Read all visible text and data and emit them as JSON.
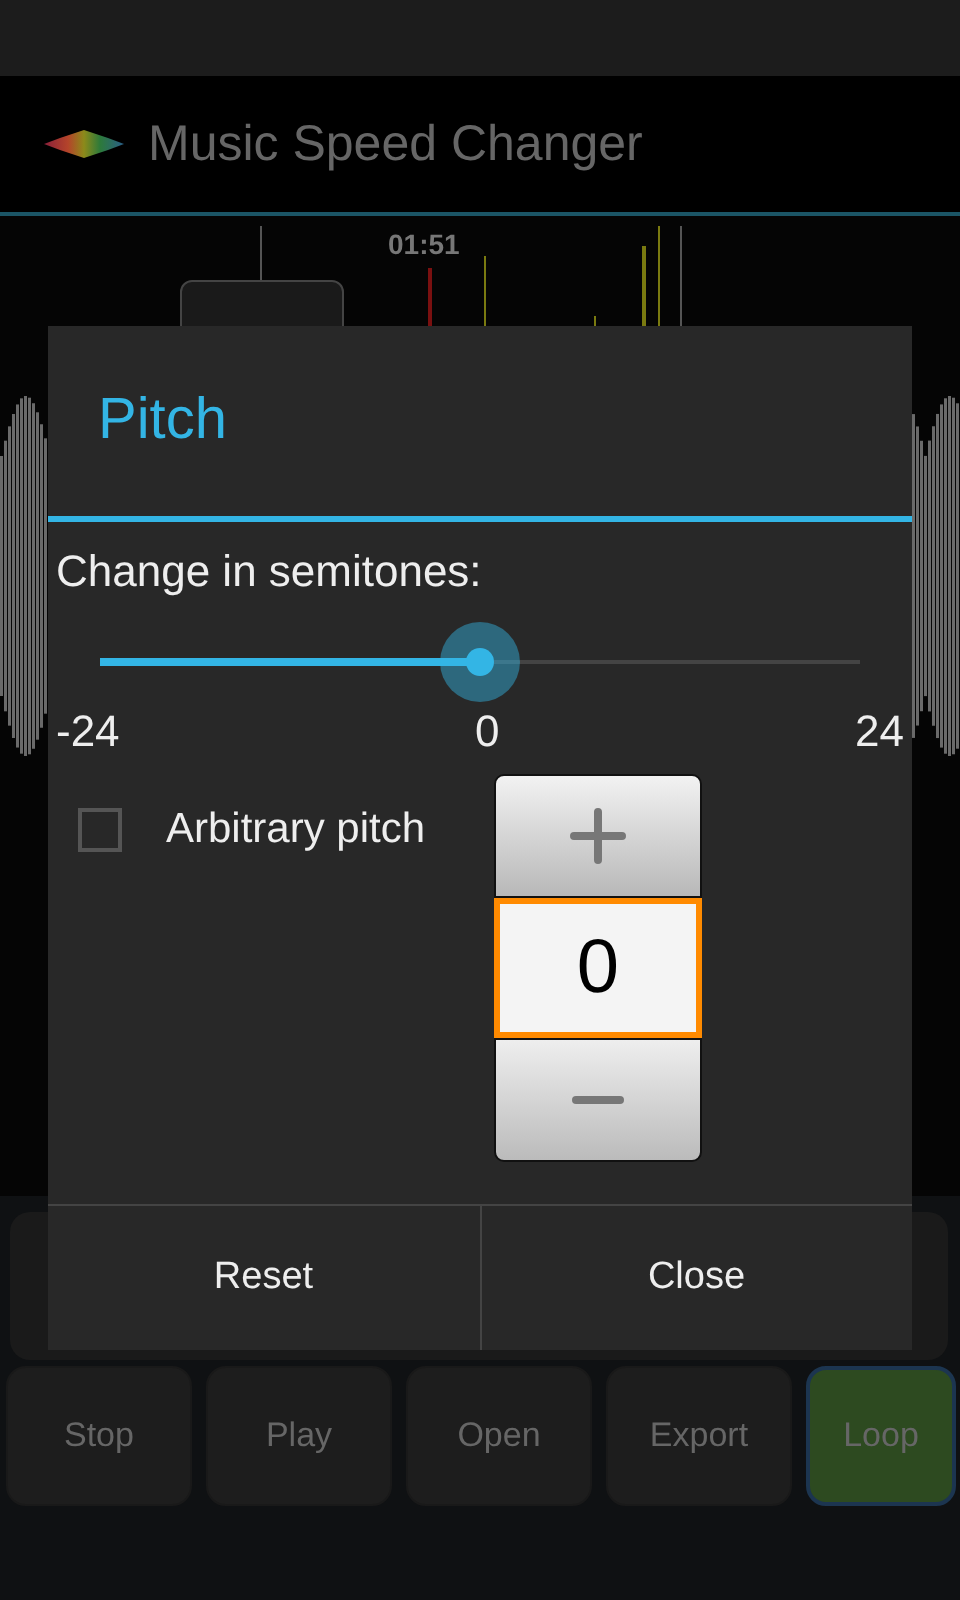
{
  "app": {
    "title": "Music Speed Changer"
  },
  "waveform": {
    "time": "01:51"
  },
  "buttons": [
    {
      "label": "Stop",
      "selected": false
    },
    {
      "label": "Play",
      "selected": false
    },
    {
      "label": "Open",
      "selected": false
    },
    {
      "label": "Export",
      "selected": false
    },
    {
      "label": "Loop",
      "selected": true
    }
  ],
  "dialog": {
    "title": "Pitch",
    "label": "Change in semitones:",
    "slider": {
      "level": 0.5
    },
    "scale": [
      "-24",
      "0",
      "24"
    ],
    "arbitrary": {
      "label": "Arbitrary pitch",
      "checked": false
    },
    "picker": {
      "value": "0"
    },
    "buttons": [
      "Reset",
      "Close"
    ]
  }
}
